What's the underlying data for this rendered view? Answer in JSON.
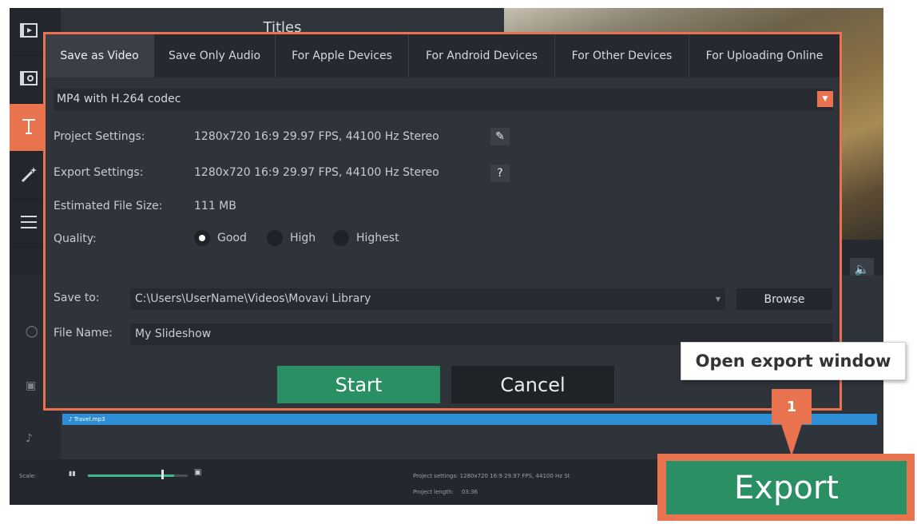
{
  "leftbar": {
    "items": [
      {
        "icon": "film-import-icon",
        "active": false
      },
      {
        "icon": "media-library-icon",
        "active": false
      },
      {
        "icon": "titles-icon",
        "active": true
      },
      {
        "icon": "magic-wand-icon",
        "active": false
      },
      {
        "icon": "menu-icon",
        "active": false
      }
    ]
  },
  "panel": {
    "title": "Titles"
  },
  "timeline": {
    "audio_clip": "Travel.mp3",
    "bottom": {
      "scale_label": "Scale:",
      "project_settings": "Project settings:  1280x720 16:9 29.97 FPS, 44100 Hz St",
      "project_length_label": "Project length:",
      "project_length_value": "03:36"
    }
  },
  "dialog": {
    "tabs": [
      {
        "label": "Save as Video",
        "active": true
      },
      {
        "label": "Save Only Audio",
        "active": false
      },
      {
        "label": "For Apple Devices",
        "active": false
      },
      {
        "label": "For Android Devices",
        "active": false
      },
      {
        "label": "For Other Devices",
        "active": false
      },
      {
        "label": "For Uploading Online",
        "active": false
      }
    ],
    "format": "MP4 with H.264 codec",
    "project_settings_label": "Project Settings:",
    "project_settings_value": "1280x720 16:9 29.97 FPS, 44100 Hz Stereo",
    "export_settings_label": "Export Settings:",
    "export_settings_value": "1280x720 16:9 29.97 FPS, 44100 Hz Stereo",
    "export_help": "?",
    "estimated_size_label": "Estimated File Size:",
    "estimated_size_value": "111 MB",
    "quality_label": "Quality:",
    "quality_options": [
      {
        "label": "Good",
        "selected": true
      },
      {
        "label": "High",
        "selected": false
      },
      {
        "label": "Highest",
        "selected": false
      }
    ],
    "save_to_label": "Save to:",
    "save_to_value": "C:\\Users\\UserName\\Videos\\Movavi Library",
    "browse_label": "Browse",
    "file_name_label": "File Name:",
    "file_name_value": "My Slideshow",
    "start_label": "Start",
    "cancel_label": "Cancel"
  },
  "annotation": {
    "tooltip": "Open export window",
    "callout_number": "1"
  },
  "export_button": "Export",
  "colors": {
    "accent": "#e9724f",
    "start_green": "#2a8f62",
    "dialog_bg": "#2f333a",
    "audio_clip": "#2e8fd6"
  }
}
